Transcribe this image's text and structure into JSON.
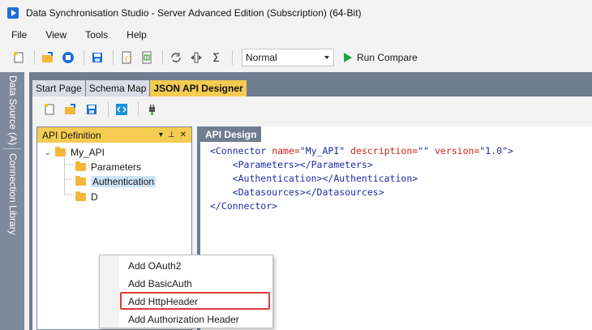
{
  "window": {
    "title": "Data Synchronisation Studio - Server Advanced Edition (Subscription) (64-Bit)"
  },
  "menu": [
    "File",
    "View",
    "Tools",
    "Help"
  ],
  "toolbar": {
    "mode_value": "Normal",
    "run_label": "Run Compare"
  },
  "side_tabs": [
    "Data Source (A)",
    "Connection Library"
  ],
  "doc_tabs": [
    "Start Page",
    "Schema Map",
    "JSON API Designer"
  ],
  "api_definition": {
    "title": "API Definition",
    "pin": "▾ ⊓ ✕",
    "tree": {
      "root": "My_API",
      "children": [
        "Parameters",
        "Authentication",
        "D"
      ]
    }
  },
  "api_design": {
    "title": "API Design",
    "lines": [
      {
        "parts": [
          [
            "tag",
            "<Connector "
          ],
          [
            "attr",
            "name="
          ],
          [
            "val",
            "\"My_API\" "
          ],
          [
            "attr",
            "description="
          ],
          [
            "val",
            "\"\" "
          ],
          [
            "attr",
            "version="
          ],
          [
            "val",
            "\"1.0\""
          ],
          [
            "tag",
            ">"
          ]
        ]
      },
      {
        "parts": [
          [
            "tag",
            "    <Parameters></Parameters>"
          ]
        ]
      },
      {
        "parts": [
          [
            "tag",
            "    <Authentication></Authentication>"
          ]
        ]
      },
      {
        "parts": [
          [
            "tag",
            "    <Datasources></Datasources>"
          ]
        ]
      },
      {
        "parts": [
          [
            "tag",
            "</Connector>"
          ]
        ]
      }
    ]
  },
  "context_menu": {
    "items": [
      "Add OAuth2",
      "Add BasicAuth",
      "Add HttpHeader",
      "Add Authorization Header"
    ],
    "highlighted_index": 2
  },
  "colors": {
    "accent_tab": "#f5cc52",
    "highlight_border": "#e03c3c",
    "workspace": "#6f7d91"
  }
}
